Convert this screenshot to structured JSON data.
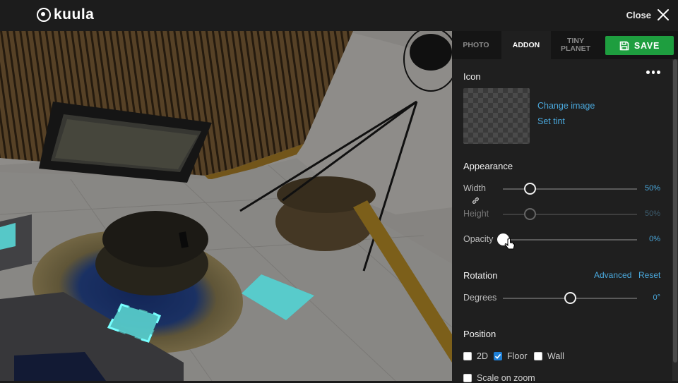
{
  "app": {
    "logo_text": "kuula",
    "close_label": "Close"
  },
  "tabs": [
    {
      "label": "PHOTO",
      "active": false
    },
    {
      "label": "ADDON",
      "active": true
    },
    {
      "label": "TINY\nPLANET",
      "active": false
    }
  ],
  "save_label": "SAVE",
  "icon_section": {
    "title": "Icon",
    "change_image": "Change image",
    "set_tint": "Set tint"
  },
  "appearance": {
    "title": "Appearance",
    "width": {
      "label": "Width",
      "value": "50%",
      "level": 0.2
    },
    "height": {
      "label": "Height",
      "value": "50%",
      "level": 0.2
    },
    "opacity": {
      "label": "Opacity",
      "value": "0%",
      "level": 0
    }
  },
  "rotation": {
    "title": "Rotation",
    "advanced": "Advanced",
    "reset": "Reset",
    "degrees": {
      "label": "Degrees",
      "value": "0°",
      "level": 0.5
    }
  },
  "position": {
    "title": "Position",
    "options": [
      {
        "label": "2D",
        "checked": false
      },
      {
        "label": "Floor",
        "checked": true
      },
      {
        "label": "Wall",
        "checked": false
      }
    ],
    "scale_on_zoom": {
      "label": "Scale on zoom",
      "checked": false
    }
  },
  "colors": {
    "accent": "#4aa8dc",
    "save": "#1e9e3f",
    "hotspot": "#5fe0e0"
  }
}
